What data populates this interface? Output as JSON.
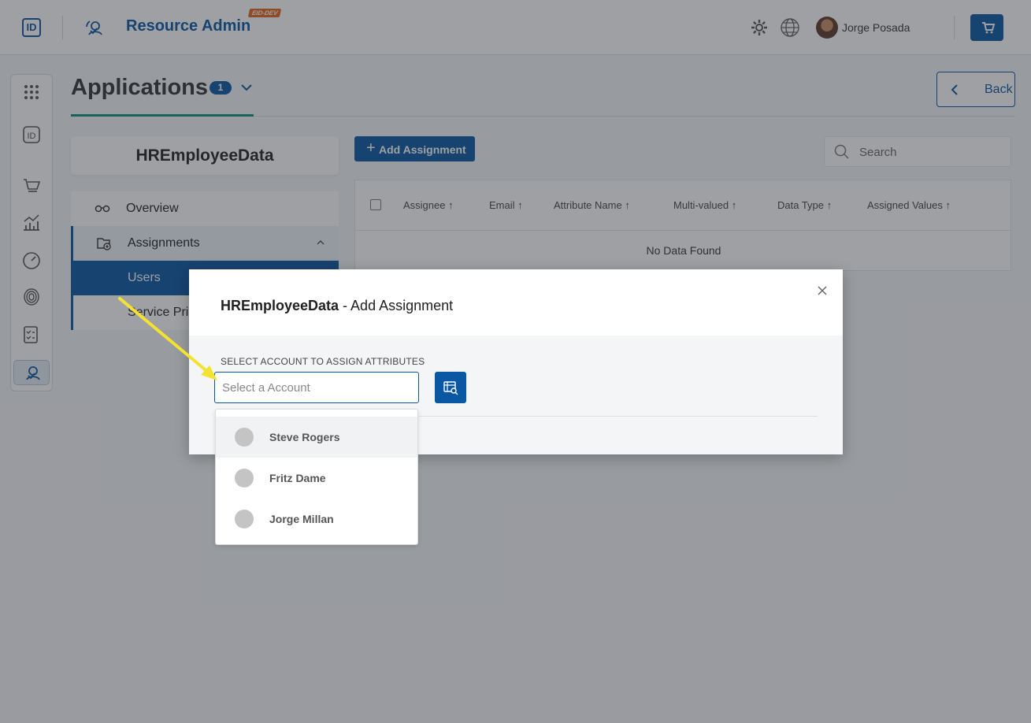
{
  "header": {
    "logo": "ID",
    "app_title": "Resource Admin",
    "env_badge": "EID-DEV",
    "user_name": "Jorge Posada",
    "icons": [
      "settings-icon",
      "globe-icon",
      "cart-icon"
    ]
  },
  "rail": {
    "icons": [
      "apps-grid-icon",
      "id-icon",
      "cart-icon",
      "analytics-icon",
      "dashboard-gauge-icon",
      "fingerprint-icon",
      "checklist-icon",
      "resource-admin-icon"
    ]
  },
  "page": {
    "title": "Applications",
    "count": "1",
    "back_label": "Back"
  },
  "left_panel": {
    "app_name": "HREmployeeData",
    "nav": [
      {
        "label": "Overview"
      },
      {
        "label": "Assignments"
      },
      {
        "label": "Users"
      },
      {
        "label": "Service Pri"
      }
    ]
  },
  "toolbar": {
    "add_label": "Add Assignment",
    "search_placeholder": "Search"
  },
  "table": {
    "columns": [
      "Assignee",
      "Email",
      "Attribute Name",
      "Multi-valued",
      "Data Type",
      "Assigned Values"
    ],
    "empty_text": "No Data Found"
  },
  "modal": {
    "title_bold": "HREmployeeData",
    "title_rest": " - Add Assignment",
    "field_label": "SELECT ACCOUNT TO ASSIGN ATTRIBUTES",
    "input_placeholder": "Select a Account",
    "input_value": ""
  },
  "dropdown": {
    "options": [
      {
        "name": "Steve Rogers"
      },
      {
        "name": "Fritz Dame"
      },
      {
        "name": "Jorge Millan"
      }
    ]
  },
  "colors": {
    "primary": "#0a57a3",
    "accent_teal": "#138a7e",
    "env_badge": "#e3641b",
    "annotation_arrow": "#f4e233"
  }
}
